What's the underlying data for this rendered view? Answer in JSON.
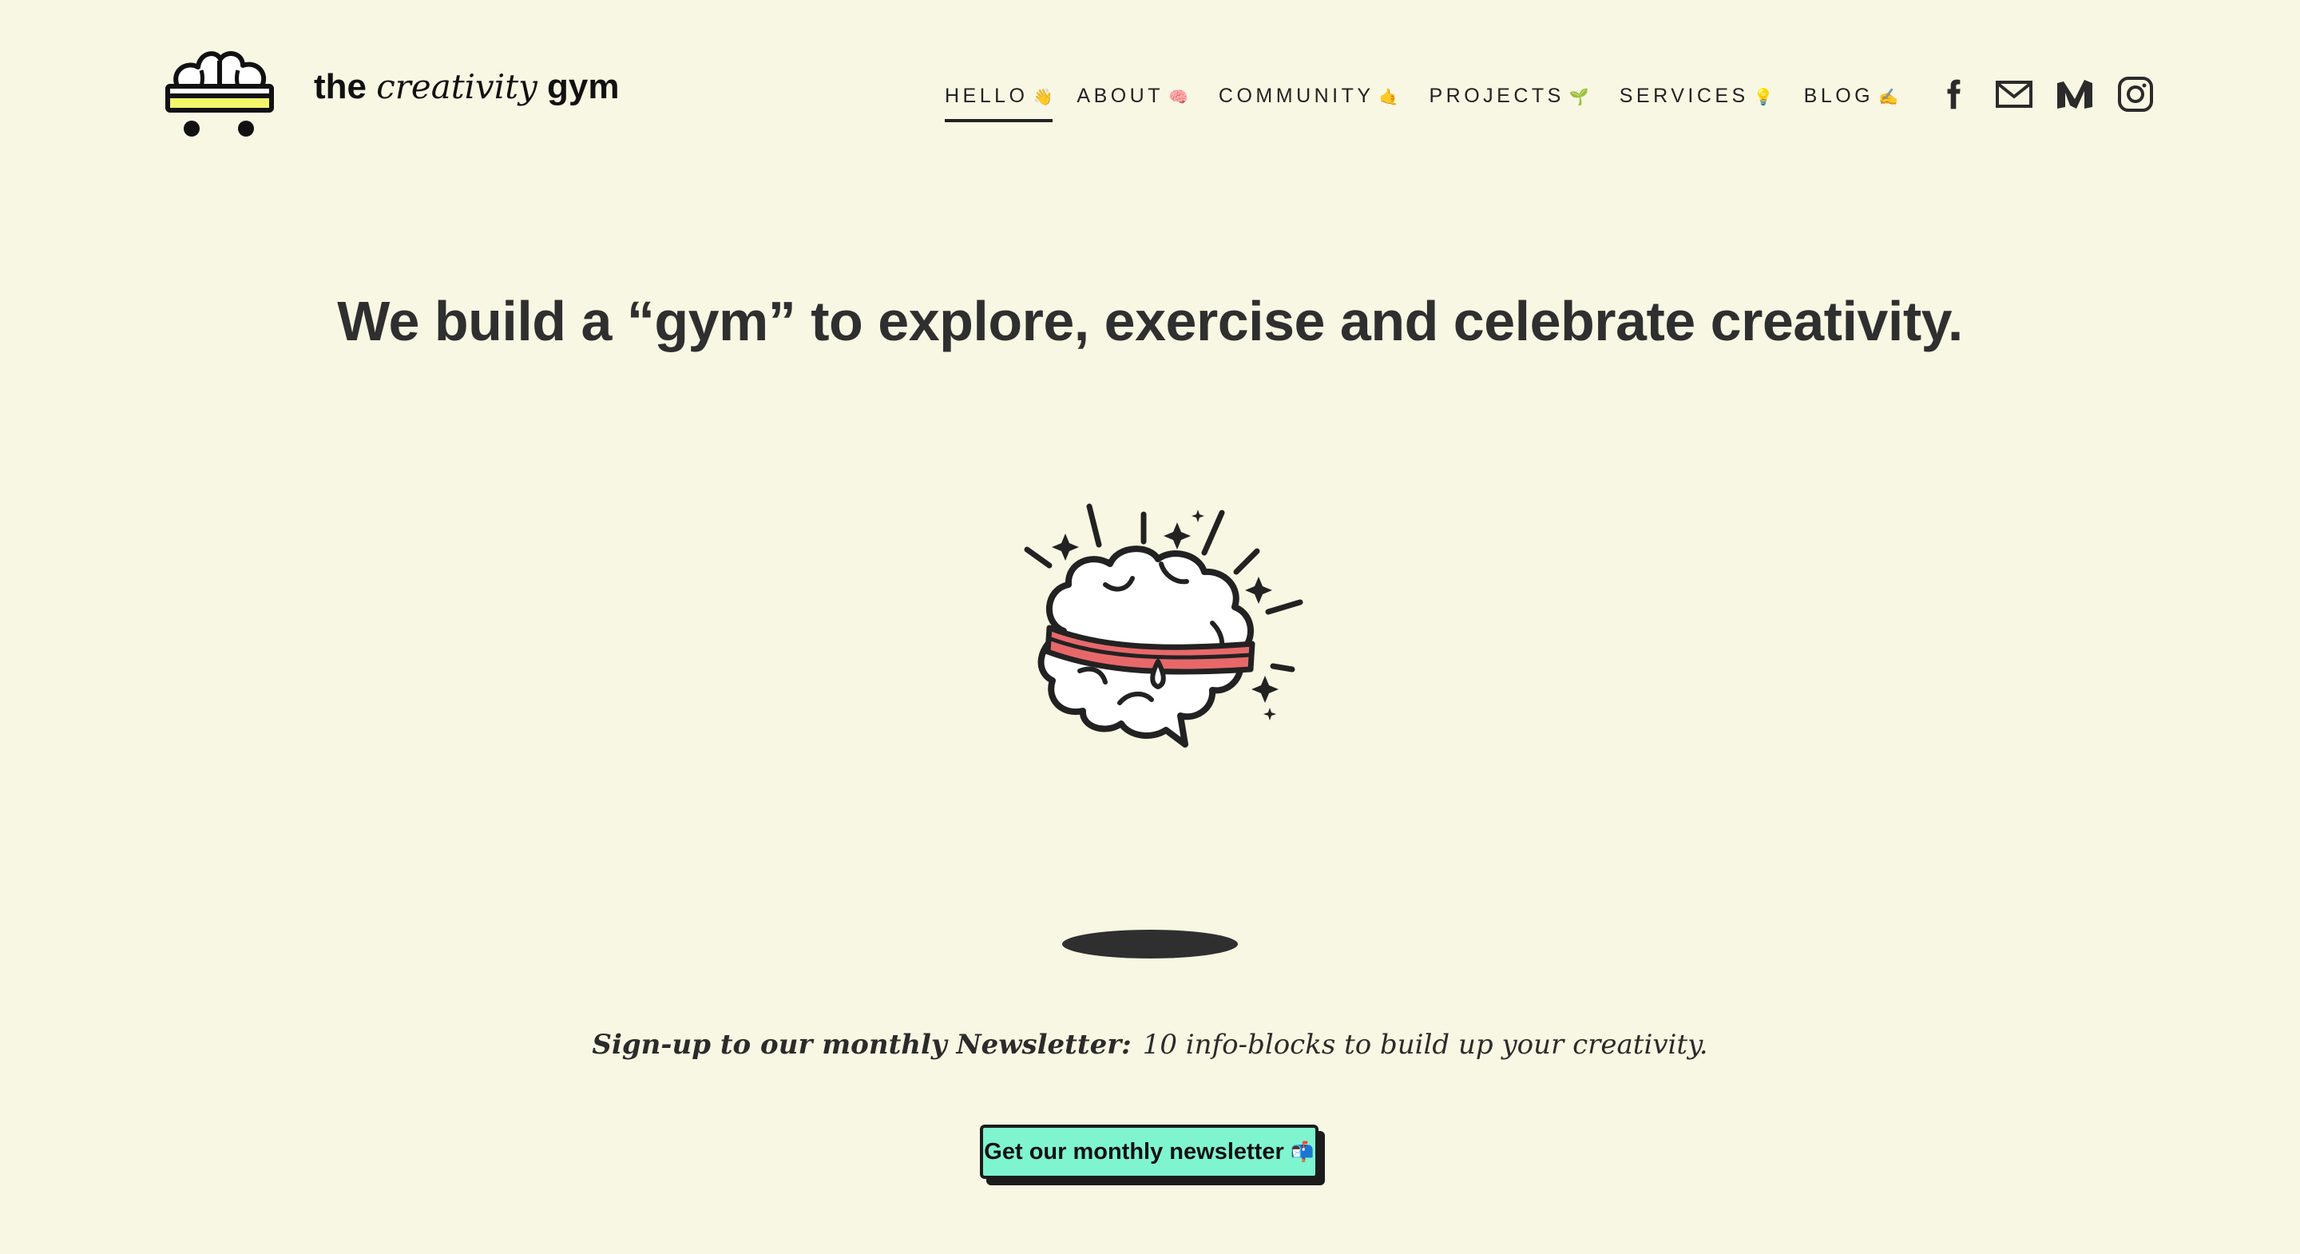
{
  "brand": {
    "name_prefix": "the",
    "name_italic": "creativity",
    "name_suffix": "gym",
    "accent_color": "#f3f76a"
  },
  "nav": {
    "items": [
      {
        "label": "HELLO",
        "emoji": "👋",
        "active": true
      },
      {
        "label": "ABOUT",
        "emoji": "🧠",
        "active": false
      },
      {
        "label": "COMMUNITY",
        "emoji": "🤙",
        "active": false
      },
      {
        "label": "PROJECTS",
        "emoji": "🌱",
        "active": false
      },
      {
        "label": "SERVICES",
        "emoji": "💡",
        "active": false
      },
      {
        "label": "BLOG",
        "emoji": "✍",
        "active": false
      }
    ],
    "social_icons": [
      "facebook-icon",
      "mail-icon",
      "medium-icon",
      "instagram-icon"
    ]
  },
  "hero": {
    "title": "We build a “gym” to explore, exercise and celebrate creativity."
  },
  "newsletter": {
    "lead": "Sign-up to our monthly Newsletter:",
    "text": "10 info-blocks to build up your creativity.",
    "button_label": "Get our monthly newsletter",
    "button_emoji": "📬",
    "button_color": "#7ef5cf"
  },
  "colors": {
    "background": "#f8f7e3",
    "headband": "#e8686a",
    "text": "#2b2b2b"
  }
}
